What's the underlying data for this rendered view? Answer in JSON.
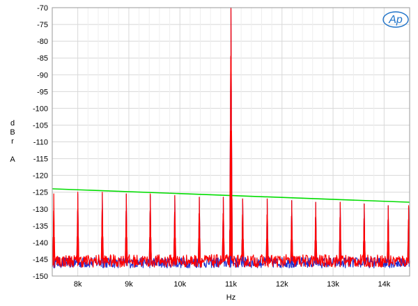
{
  "chart_data": {
    "type": "line",
    "title": "",
    "xlabel": "Hz",
    "ylabel": "dBr A",
    "ylabel_lines": [
      "d",
      "B",
      "r",
      "",
      "A"
    ],
    "xlim": [
      7500,
      14500
    ],
    "ylim": [
      -150,
      -70
    ],
    "x_ticks": [
      {
        "value": 8000,
        "label": "8k"
      },
      {
        "value": 9000,
        "label": "9k"
      },
      {
        "value": 10000,
        "label": "10k"
      },
      {
        "value": 11000,
        "label": "11k"
      },
      {
        "value": 12000,
        "label": "12k"
      },
      {
        "value": 13000,
        "label": "13k"
      },
      {
        "value": 14000,
        "label": "14k"
      }
    ],
    "y_ticks": [
      {
        "value": -70,
        "label": "-70"
      },
      {
        "value": -75,
        "label": "-75"
      },
      {
        "value": -80,
        "label": "-80"
      },
      {
        "value": -85,
        "label": "-85"
      },
      {
        "value": -90,
        "label": "-90"
      },
      {
        "value": -95,
        "label": "-95"
      },
      {
        "value": -100,
        "label": "-100"
      },
      {
        "value": -105,
        "label": "-105"
      },
      {
        "value": -110,
        "label": "-110"
      },
      {
        "value": -115,
        "label": "-115"
      },
      {
        "value": -120,
        "label": "-120"
      },
      {
        "value": -125,
        "label": "-125"
      },
      {
        "value": -130,
        "label": "-130"
      },
      {
        "value": -135,
        "label": "-135"
      },
      {
        "value": -140,
        "label": "-140"
      },
      {
        "value": -145,
        "label": "-145"
      },
      {
        "value": -150,
        "label": "-150"
      }
    ],
    "grid": true,
    "legend": "none",
    "series": [
      {
        "color": "#00dd00",
        "x": [
          7500,
          14500
        ],
        "y": [
          -124.0,
          -128.0
        ]
      },
      {
        "color": "#1f2fd0",
        "noise_floor": -146.0,
        "peaks": [
          {
            "x": 8000,
            "y": -125.5
          },
          {
            "x": 8480,
            "y": -125.5
          },
          {
            "x": 8950,
            "y": -125.5
          },
          {
            "x": 9420,
            "y": -126.0
          },
          {
            "x": 9900,
            "y": -126.0
          },
          {
            "x": 10380,
            "y": -126.5
          },
          {
            "x": 10850,
            "y": -126.5
          },
          {
            "x": 11000,
            "y": -70.0
          },
          {
            "x": 11230,
            "y": -127.0
          },
          {
            "x": 11710,
            "y": -127.0
          },
          {
            "x": 12190,
            "y": -127.5
          },
          {
            "x": 12660,
            "y": -128.0
          },
          {
            "x": 13140,
            "y": -128.0
          },
          {
            "x": 13610,
            "y": -128.5
          },
          {
            "x": 14080,
            "y": -129.0
          },
          {
            "x": 14480,
            "y": -129.5
          }
        ]
      },
      {
        "color": "#ff0000",
        "noise_floor": -145.5,
        "peaks": [
          {
            "x": 7530,
            "y": -125.5
          },
          {
            "x": 8000,
            "y": -125.0
          },
          {
            "x": 8480,
            "y": -125.0
          },
          {
            "x": 8950,
            "y": -125.5
          },
          {
            "x": 9420,
            "y": -125.5
          },
          {
            "x": 9900,
            "y": -126.0
          },
          {
            "x": 10380,
            "y": -126.5
          },
          {
            "x": 10850,
            "y": -126.5
          },
          {
            "x": 11000,
            "y": -70.0
          },
          {
            "x": 11230,
            "y": -127.0
          },
          {
            "x": 11710,
            "y": -127.0
          },
          {
            "x": 12190,
            "y": -127.5
          },
          {
            "x": 12660,
            "y": -128.0
          },
          {
            "x": 13140,
            "y": -128.0
          },
          {
            "x": 13610,
            "y": -128.5
          },
          {
            "x": 14080,
            "y": -129.0
          },
          {
            "x": 14480,
            "y": -129.0
          }
        ]
      }
    ]
  },
  "logo": {
    "text": "Ap",
    "icon": "audio-precision-logo",
    "color": "#1f73c9"
  }
}
